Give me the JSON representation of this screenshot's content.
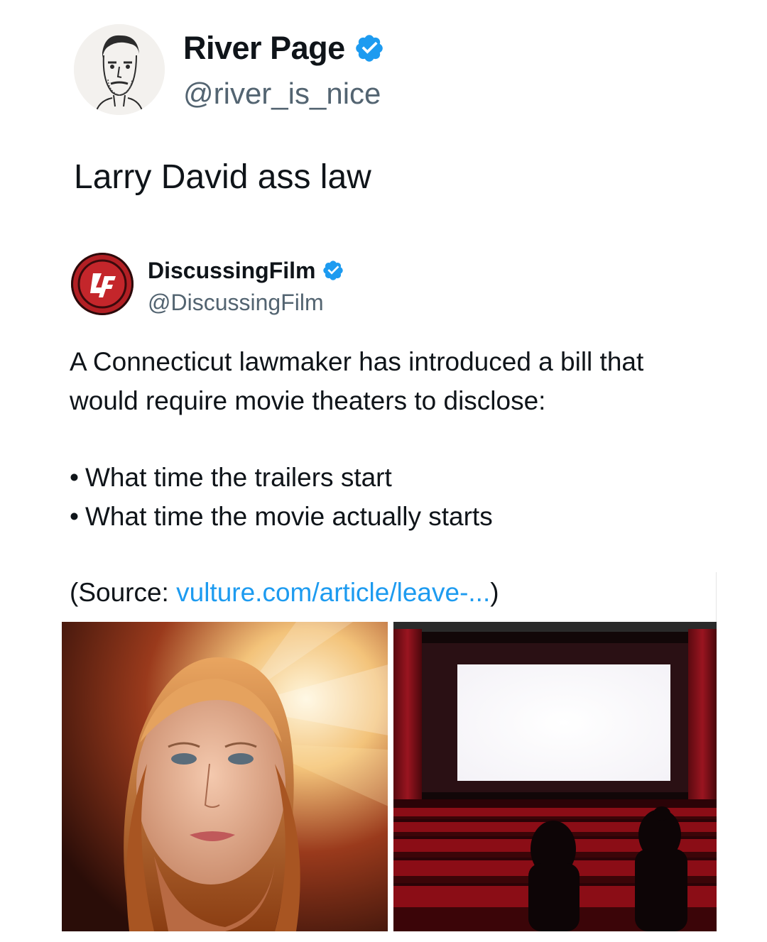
{
  "author": {
    "name": "River Page",
    "handle": "@river_is_nice",
    "verified_icon": "verified-badge-icon",
    "avatar_icon": "sketch-portrait-avatar"
  },
  "tweet": {
    "text": "Larry David ass law"
  },
  "quoted": {
    "name": "DiscussingFilm",
    "handle": "@DiscussingFilm",
    "logo_text": "DF",
    "body": "A Connecticut lawmaker has introduced a bill that would require movie theaters to disclose:",
    "bullets": [
      "What time the trailers start",
      "What time the movie actually starts"
    ],
    "source_prefix": "(Source: ",
    "source_link": "vulture.com/article/leave-...",
    "source_suffix": ")"
  },
  "colors": {
    "verified": "#1d9bf0",
    "link": "#1d9bf0",
    "logo_red": "#b21f24",
    "seat_red": "#8b0d16"
  }
}
